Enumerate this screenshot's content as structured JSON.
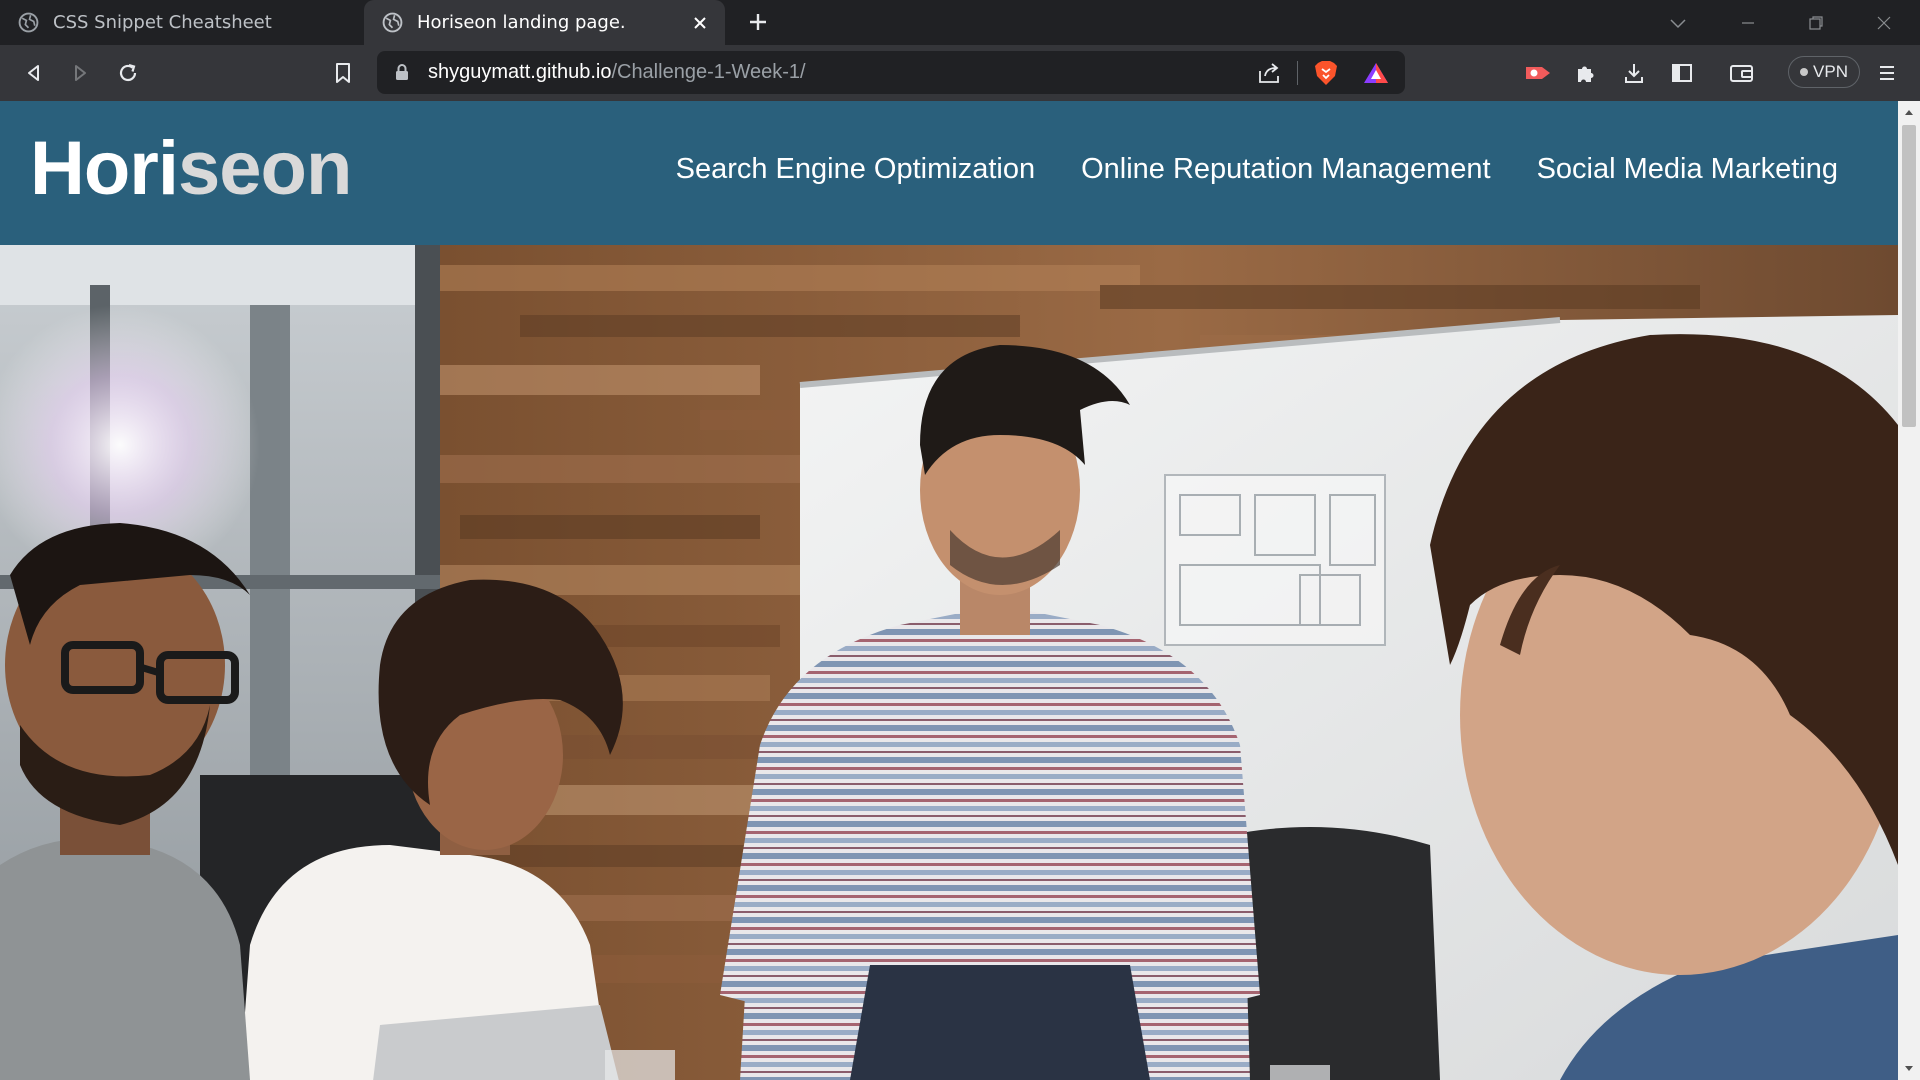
{
  "browser": {
    "tabs": [
      {
        "title": "CSS Snippet Cheatsheet",
        "favicon": "globe-icon",
        "active": false
      },
      {
        "title": "Horiseon landing page.",
        "favicon": "globe-icon",
        "active": true
      }
    ],
    "url": {
      "host": "shyguymatt.github.io",
      "path": "/Challenge-1-Week-1/"
    },
    "vpn_label": "VPN",
    "accent_color": "#2a607c"
  },
  "page": {
    "logo": {
      "main": "Hori",
      "accent": "seon"
    },
    "nav": [
      "Search Engine Optimization",
      "Online Reputation Management",
      "Social Media Marketing"
    ],
    "hero_image": "team-meeting-photo"
  }
}
